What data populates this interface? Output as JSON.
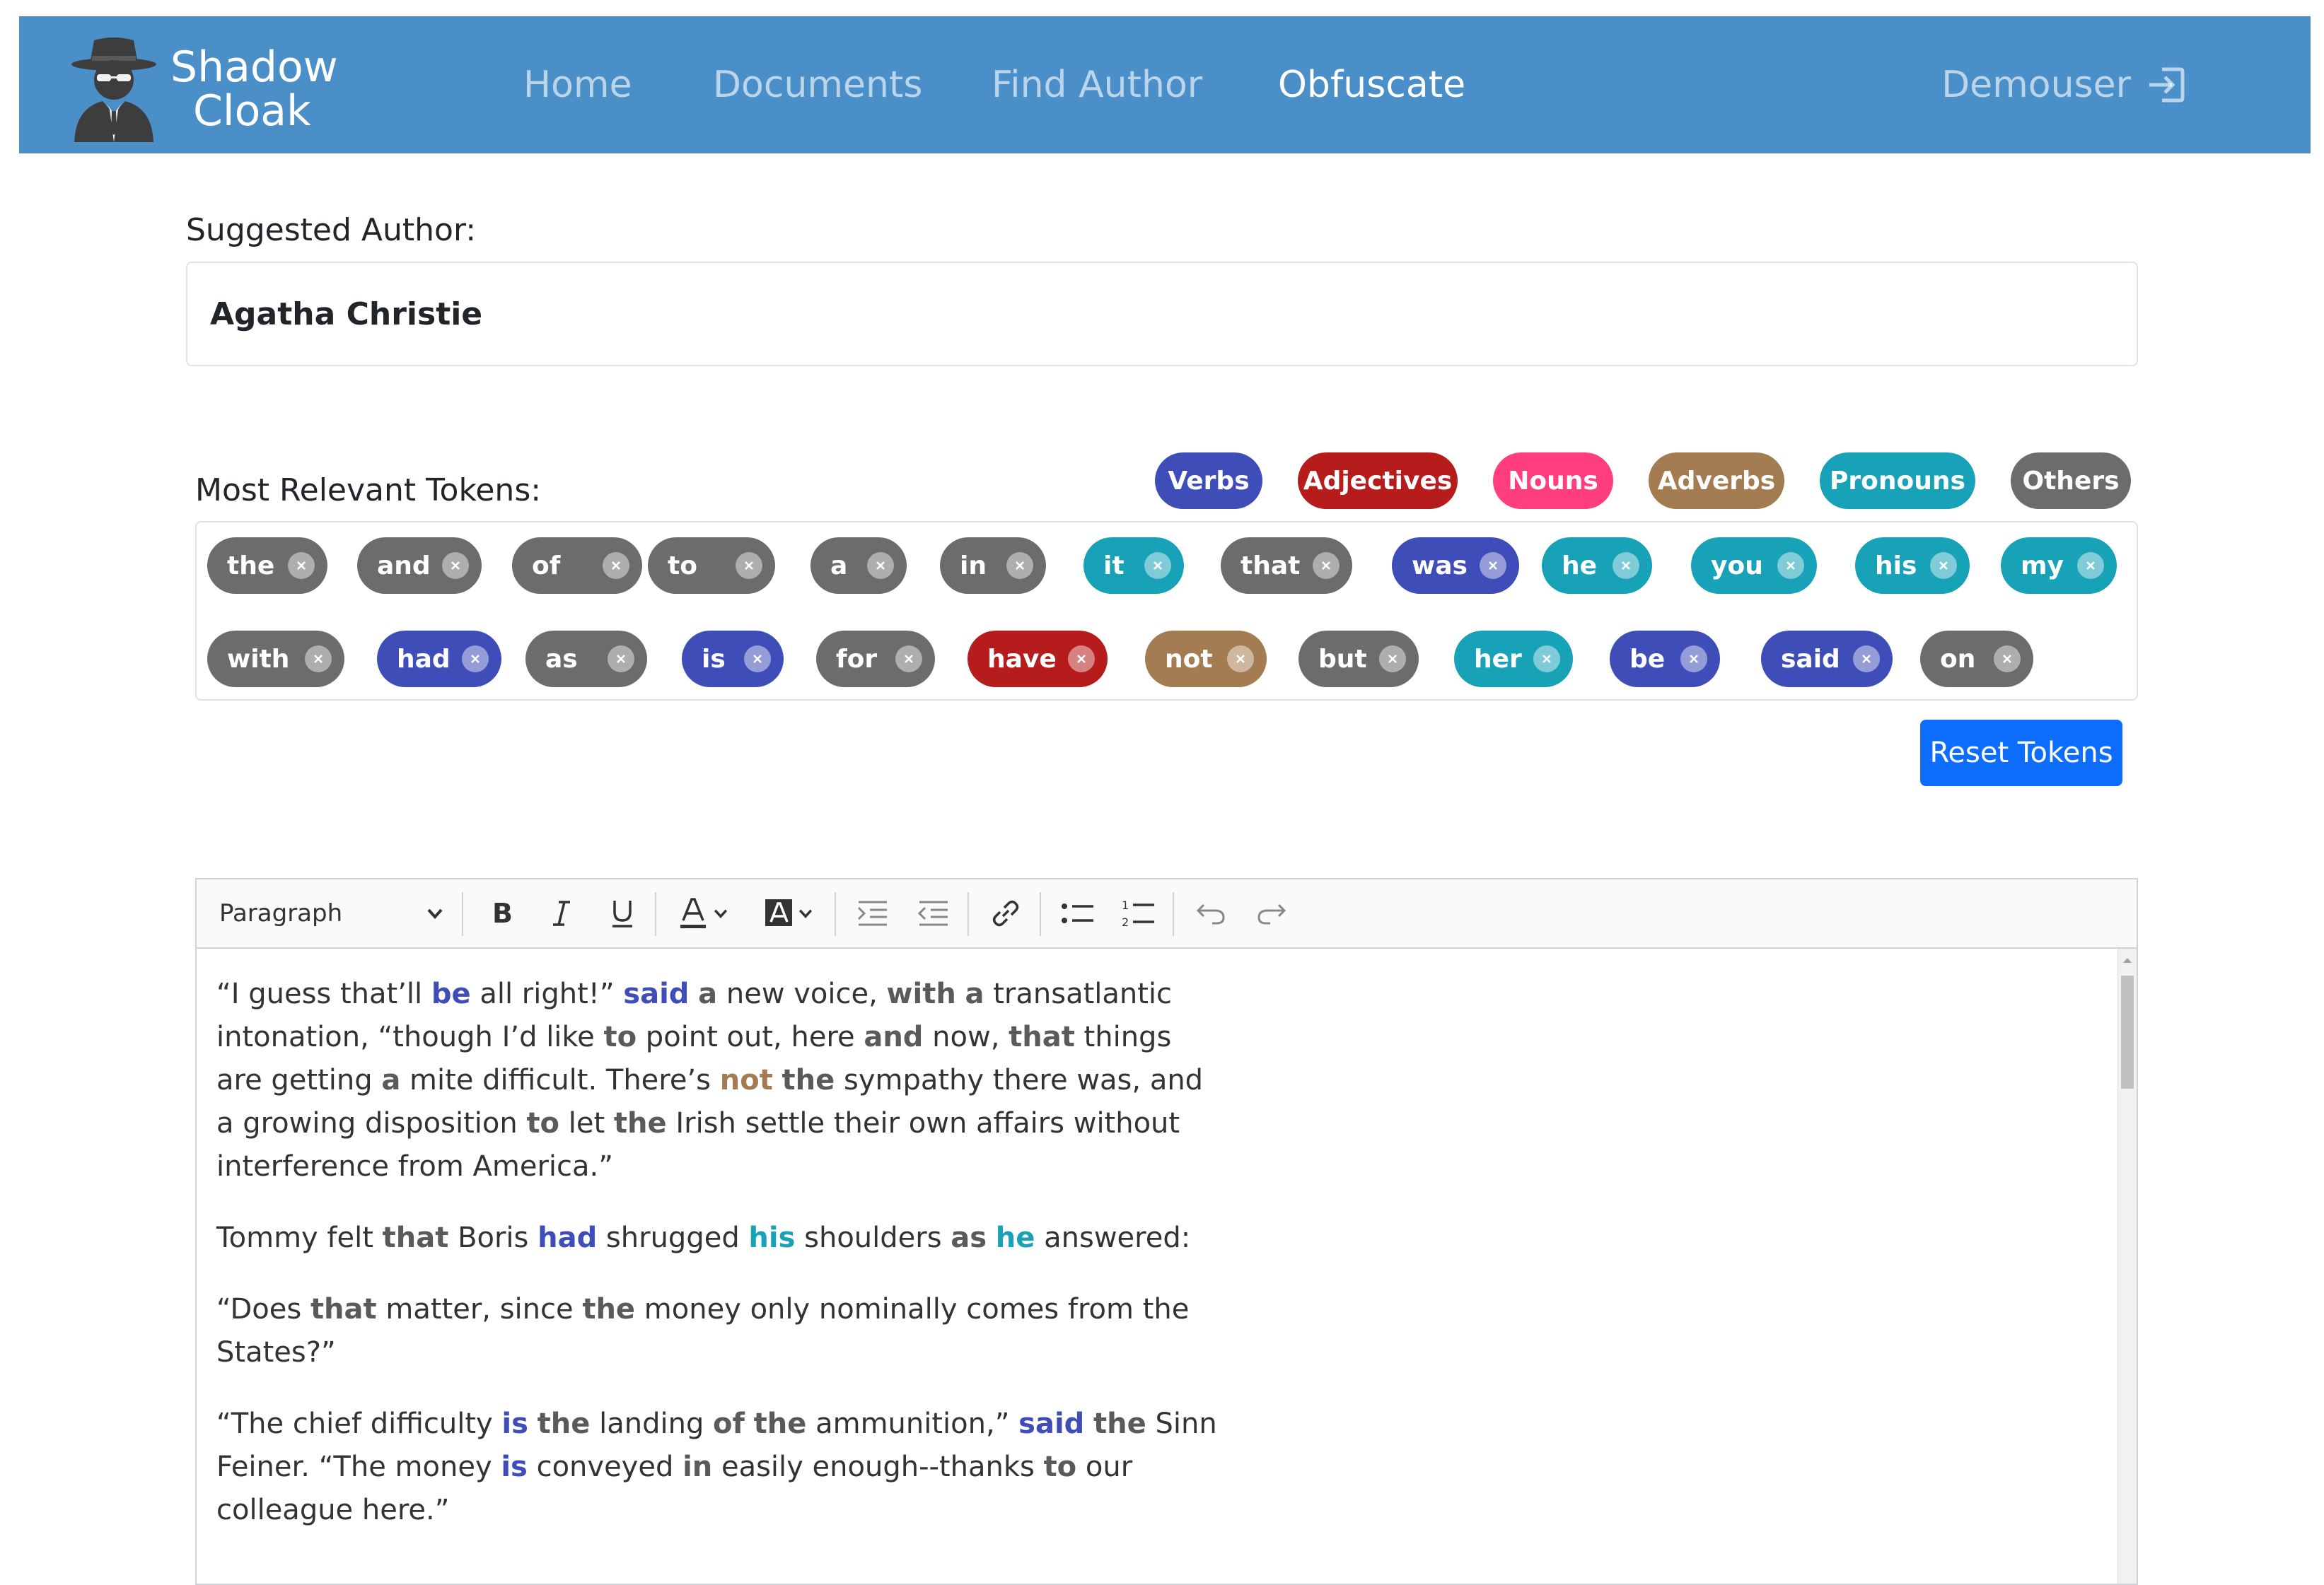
{
  "brand": {
    "line1": "Shadow",
    "line2": "Cloak",
    "logo_icon": "spy-icon"
  },
  "nav": {
    "items": [
      {
        "label": "Home",
        "active": false
      },
      {
        "label": "Documents",
        "active": false
      },
      {
        "label": "Find Author",
        "active": false
      },
      {
        "label": "Obfuscate",
        "active": true
      }
    ],
    "user": {
      "label": "Demouser",
      "icon": "logout-icon"
    }
  },
  "author": {
    "label": "Suggested Author:",
    "value": "Agatha Christie"
  },
  "tokens": {
    "label": "Most Relevant Tokens:",
    "legend": [
      {
        "label": "Verbs",
        "color": "#3f4db8"
      },
      {
        "label": "Adjectives",
        "color": "#b71c1c"
      },
      {
        "label": "Nouns",
        "color": "#ff3d7f"
      },
      {
        "label": "Adverbs",
        "color": "#a47c51"
      },
      {
        "label": "Pronouns",
        "color": "#17a2b8"
      },
      {
        "label": "Others",
        "color": "#6c6c6c"
      }
    ],
    "row1": [
      {
        "word": "the",
        "category": "Others"
      },
      {
        "word": "and",
        "category": "Others"
      },
      {
        "word": "of",
        "category": "Others"
      },
      {
        "word": "to",
        "category": "Others"
      },
      {
        "word": "a",
        "category": "Others"
      },
      {
        "word": "in",
        "category": "Others"
      },
      {
        "word": "it",
        "category": "Pronouns"
      },
      {
        "word": "that",
        "category": "Others"
      },
      {
        "word": "was",
        "category": "Verbs"
      },
      {
        "word": "he",
        "category": "Pronouns"
      },
      {
        "word": "you",
        "category": "Pronouns"
      },
      {
        "word": "his",
        "category": "Pronouns"
      },
      {
        "word": "my",
        "category": "Pronouns"
      }
    ],
    "row2": [
      {
        "word": "with",
        "category": "Others"
      },
      {
        "word": "had",
        "category": "Verbs"
      },
      {
        "word": "as",
        "category": "Others"
      },
      {
        "word": "is",
        "category": "Verbs"
      },
      {
        "word": "for",
        "category": "Others"
      },
      {
        "word": "have",
        "category": "Adjectives"
      },
      {
        "word": "not",
        "category": "Adverbs"
      },
      {
        "word": "but",
        "category": "Others"
      },
      {
        "word": "her",
        "category": "Pronouns"
      },
      {
        "word": "be",
        "category": "Verbs"
      },
      {
        "word": "said",
        "category": "Verbs"
      },
      {
        "word": "on",
        "category": "Others"
      }
    ],
    "reset_label": "Reset Tokens"
  },
  "editor": {
    "block_format": "Paragraph",
    "toolbar_icons": [
      "bold-icon",
      "italic-icon",
      "underline-icon",
      "font-color-icon",
      "highlight-color-icon",
      "indent-icon",
      "outdent-icon",
      "link-icon",
      "bulleted-list-icon",
      "numbered-list-icon",
      "undo-icon",
      "redo-icon"
    ],
    "paragraphs": [
      [
        [
          "“I guess that’ll ",
          ""
        ],
        [
          "be",
          "verb"
        ],
        [
          " all right!” ",
          ""
        ],
        [
          "said",
          "verb"
        ],
        [
          " ",
          ""
        ],
        [
          "a",
          "other"
        ],
        [
          " new voice, ",
          ""
        ],
        [
          "with",
          "other"
        ],
        [
          " ",
          ""
        ],
        [
          "a",
          "other"
        ],
        [
          " transatlantic intonation, “though I’d like ",
          ""
        ],
        [
          "to",
          "other"
        ],
        [
          " point out, here ",
          ""
        ],
        [
          "and",
          "other"
        ],
        [
          " now, ",
          ""
        ],
        [
          "that",
          "other"
        ],
        [
          " things are getting ",
          ""
        ],
        [
          "a",
          "other"
        ],
        [
          " mite difficult. There’s ",
          ""
        ],
        [
          "not",
          "adv"
        ],
        [
          " ",
          ""
        ],
        [
          "the",
          "other"
        ],
        [
          " sympathy there was, and a growing disposition ",
          ""
        ],
        [
          "to",
          "other"
        ],
        [
          " let ",
          ""
        ],
        [
          "the",
          "other"
        ],
        [
          " Irish settle their own affairs without interference from America.”",
          ""
        ]
      ],
      [
        [
          "Tommy felt ",
          ""
        ],
        [
          "that",
          "other"
        ],
        [
          " Boris ",
          ""
        ],
        [
          "had",
          "verb"
        ],
        [
          " shrugged ",
          ""
        ],
        [
          "his",
          "pron"
        ],
        [
          " shoulders ",
          ""
        ],
        [
          "as",
          "other"
        ],
        [
          " ",
          ""
        ],
        [
          "he",
          "pron"
        ],
        [
          " answered:",
          ""
        ]
      ],
      [
        [
          "“Does ",
          ""
        ],
        [
          "that",
          "other"
        ],
        [
          " matter, since ",
          ""
        ],
        [
          "the",
          "other"
        ],
        [
          " money only nominally comes from the States?”",
          ""
        ]
      ],
      [
        [
          "“The chief difficulty ",
          ""
        ],
        [
          "is",
          "verb"
        ],
        [
          " ",
          ""
        ],
        [
          "the",
          "other"
        ],
        [
          " landing ",
          ""
        ],
        [
          "of",
          "other"
        ],
        [
          " ",
          ""
        ],
        [
          "the",
          "other"
        ],
        [
          " ammunition,” ",
          ""
        ],
        [
          "said",
          "verb"
        ],
        [
          " ",
          ""
        ],
        [
          "the",
          "other"
        ],
        [
          " Sinn Feiner. “The money ",
          ""
        ],
        [
          "is",
          "verb"
        ],
        [
          " conveyed ",
          ""
        ],
        [
          "in",
          "other"
        ],
        [
          " easily enough--thanks ",
          ""
        ],
        [
          "to",
          "other"
        ],
        [
          " our colleague here.”",
          ""
        ]
      ]
    ]
  }
}
